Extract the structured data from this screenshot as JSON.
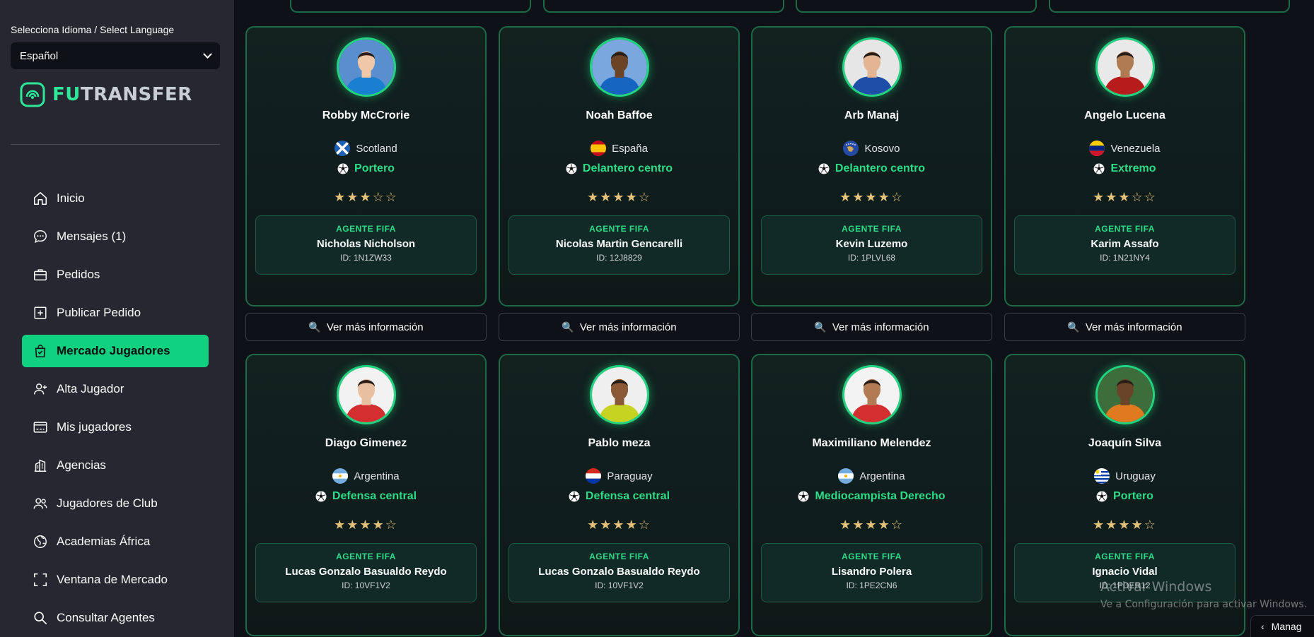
{
  "sidebar": {
    "language_label": "Selecciona Idioma / Select Language",
    "language_value": "Español",
    "logo_fu": "FU",
    "logo_rest": "TRANSFER",
    "nav": [
      {
        "label": "Inicio",
        "icon": "home-icon"
      },
      {
        "label": "Mensajes (1)",
        "icon": "chat-icon"
      },
      {
        "label": "Pedidos",
        "icon": "briefcase-icon"
      },
      {
        "label": "Publicar Pedido",
        "icon": "plus-square-icon"
      },
      {
        "label": "Mercado Jugadores",
        "icon": "shopping-bag-icon",
        "active": true
      },
      {
        "label": "Alta Jugador",
        "icon": "user-plus-icon"
      },
      {
        "label": "Mis jugadores",
        "icon": "id-card-icon"
      },
      {
        "label": "Agencias",
        "icon": "building-icon"
      },
      {
        "label": "Jugadores de Club",
        "icon": "users-icon"
      },
      {
        "label": "Academias África",
        "icon": "globe-icon"
      },
      {
        "label": "Ventana de Mercado",
        "icon": "frame-icon"
      },
      {
        "label": "Consultar Agentes",
        "icon": "search-icon"
      }
    ]
  },
  "colors": {
    "accent": "#10d180",
    "card_border": "#1d6a47",
    "star": "#e2c079",
    "position_text": "#2ddc87"
  },
  "agent_label": "AGENTE FIFA",
  "more_button_label": "Ver más información",
  "players": [
    {
      "name": "Robby McCrorie",
      "country": "Scotland",
      "flag": "scotland",
      "position": "Portero",
      "stars": "★★★☆☆",
      "agent": "Nicholas Nicholson",
      "agent_id": "ID: 1N1ZW33"
    },
    {
      "name": "Noah Baffoe",
      "country": "España",
      "flag": "spain",
      "position": "Delantero centro",
      "stars": "★★★★☆",
      "agent": "Nicolas Martin Gencarelli",
      "agent_id": "ID: 12J8829"
    },
    {
      "name": "Arb Manaj",
      "country": "Kosovo",
      "flag": "kosovo",
      "position": "Delantero centro",
      "stars": "★★★★☆",
      "agent": "Kevin Luzemo",
      "agent_id": "ID: 1PLVL68"
    },
    {
      "name": "Angelo Lucena",
      "country": "Venezuela",
      "flag": "venezuela",
      "position": "Extremo",
      "stars": "★★★☆☆",
      "agent": "Karim Assafo",
      "agent_id": "ID: 1N21NY4"
    },
    {
      "name": "Diago Gimenez",
      "country": "Argentina",
      "flag": "argentina",
      "position": "Defensa central",
      "stars": "★★★★☆",
      "agent": "Lucas Gonzalo Basualdo Reydo",
      "agent_id": "ID: 10VF1V2"
    },
    {
      "name": "Pablo meza",
      "country": "Paraguay",
      "flag": "paraguay",
      "position": "Defensa central",
      "stars": "★★★★☆",
      "agent": "Lucas Gonzalo Basualdo Reydo",
      "agent_id": "ID: 10VF1V2"
    },
    {
      "name": "Maximiliano Melendez",
      "country": "Argentina",
      "flag": "argentina",
      "position": "Mediocampista Derecho",
      "stars": "★★★★☆",
      "agent": "Lisandro Polera",
      "agent_id": "ID: 1PE2CN6"
    },
    {
      "name": "Joaquín Silva",
      "country": "Uruguay",
      "flag": "uruguay",
      "position": "Portero",
      "stars": "★★★★☆",
      "agent": "Ignacio Vidal",
      "agent_id": "ID: 1PDER12"
    }
  ],
  "watermark": {
    "title": "Activar Windows",
    "subtitle": "Ve a Configuración para activar Windows."
  },
  "manage_label": "Manag"
}
